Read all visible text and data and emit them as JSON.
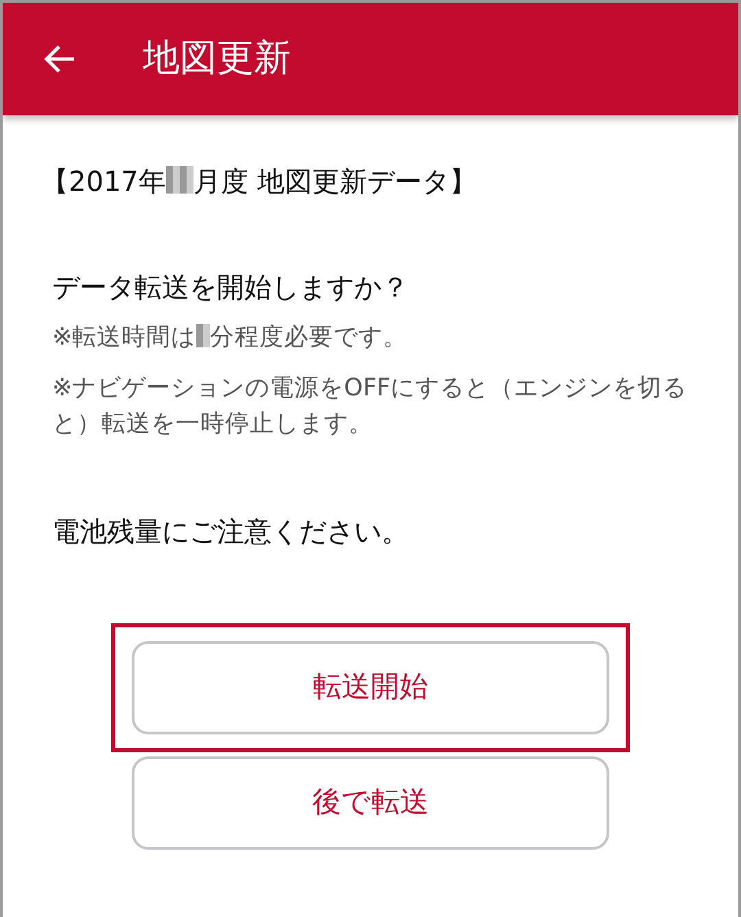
{
  "app_bar": {
    "title": "地図更新"
  },
  "heading": {
    "parts": [
      "【2017年",
      "月度 地図更新データ】"
    ]
  },
  "question": "データ転送を開始しますか？",
  "notes": [
    {
      "parts": [
        "※転送時間は",
        "分程度必要です。"
      ]
    },
    {
      "parts": [
        "※ナビゲーションの電源をOFFにすると（エンジンを切ると）転送を一時停止します。"
      ]
    }
  ],
  "warning": "電池残量にご注意ください。",
  "buttons": [
    {
      "label": "転送開始",
      "highlighted": true
    },
    {
      "label": "後で転送",
      "highlighted": false
    }
  ]
}
